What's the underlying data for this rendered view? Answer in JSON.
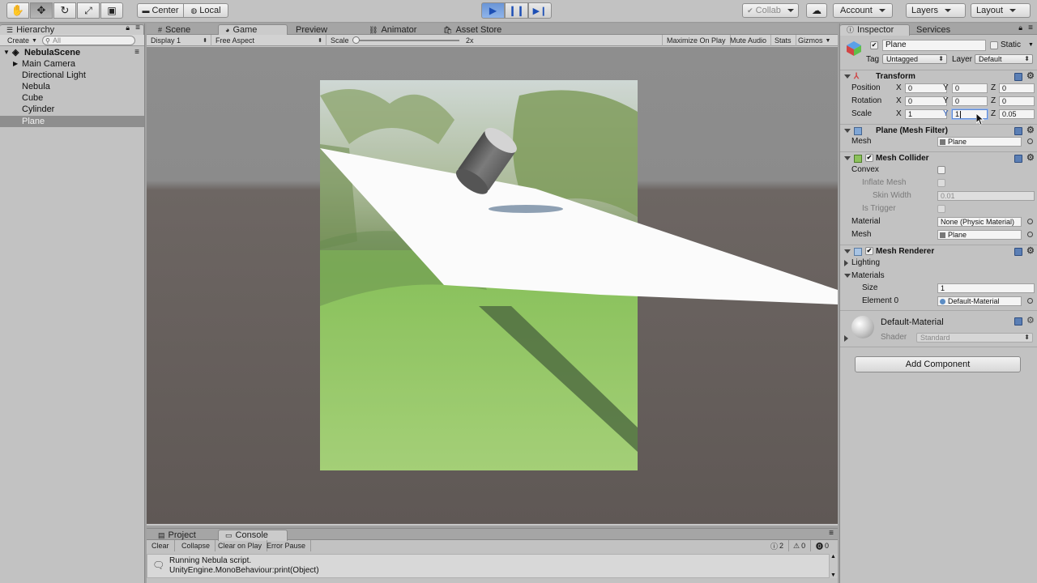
{
  "toolbar": {
    "center_label": "Center",
    "local_label": "Local",
    "collab_label": "Collab",
    "account_label": "Account",
    "layers_label": "Layers",
    "layout_label": "Layout"
  },
  "hierarchy": {
    "tab_label": "Hierarchy",
    "create_label": "Create",
    "search_placeholder": "All",
    "scene_name": "NebulaScene",
    "items": [
      {
        "label": "Main Camera"
      },
      {
        "label": "Directional Light"
      },
      {
        "label": "Nebula"
      },
      {
        "label": "Cube"
      },
      {
        "label": "Cylinder"
      },
      {
        "label": "Plane",
        "selected": true
      }
    ]
  },
  "center_tabs": {
    "scene": "Scene",
    "game": "Game",
    "preview": "Preview",
    "animator": "Animator",
    "asset_store": "Asset Store"
  },
  "game_bar": {
    "display": "Display 1",
    "aspect": "Free Aspect",
    "scale_label": "Scale",
    "scale_value": "2x",
    "scale_fraction": 0.0,
    "maximize": "Maximize On Play",
    "mute": "Mute Audio",
    "stats": "Stats",
    "gizmos": "Gizmos"
  },
  "console": {
    "project_tab": "Project",
    "console_tab": "Console",
    "clear": "Clear",
    "collapse": "Collapse",
    "clear_on_play": "Clear on Play",
    "error_pause": "Error Pause",
    "count_info": "2",
    "count_warn": "0",
    "count_error": "0",
    "log_line1": "Running Nebula script.",
    "log_line2": "UnityEngine.MonoBehaviour:print(Object)"
  },
  "inspector": {
    "tab_inspector": "Inspector",
    "tab_services": "Services",
    "object_name": "Plane",
    "static_label": "Static",
    "tag_label": "Tag",
    "tag_value": "Untagged",
    "layer_label": "Layer",
    "layer_value": "Default",
    "transform": {
      "title": "Transform",
      "position_label": "Position",
      "rotation_label": "Rotation",
      "scale_label": "Scale",
      "x": "X",
      "y": "Y",
      "z": "Z",
      "position": [
        "0",
        "0",
        "0"
      ],
      "rotation": [
        "0",
        "0",
        "0"
      ],
      "scale": [
        "1",
        "1",
        "0.05"
      ]
    },
    "mesh_filter": {
      "title": "Plane (Mesh Filter)",
      "mesh_label": "Mesh",
      "mesh_value": "Plane"
    },
    "mesh_collider": {
      "title": "Mesh Collider",
      "convex_label": "Convex",
      "inflate_label": "Inflate Mesh",
      "skin_label": "Skin Width",
      "skin_value": "0.01",
      "trigger_label": "Is Trigger",
      "material_label": "Material",
      "material_value": "None (Physic Material)",
      "mesh_label": "Mesh",
      "mesh_value": "Plane"
    },
    "mesh_renderer": {
      "title": "Mesh Renderer",
      "lighting_label": "Lighting",
      "materials_label": "Materials",
      "size_label": "Size",
      "size_value": "1",
      "element_label": "Element 0",
      "element_value": "Default-Material"
    },
    "material": {
      "name": "Default-Material",
      "shader_label": "Shader",
      "shader_value": "Standard"
    },
    "add_component": "Add Component"
  }
}
